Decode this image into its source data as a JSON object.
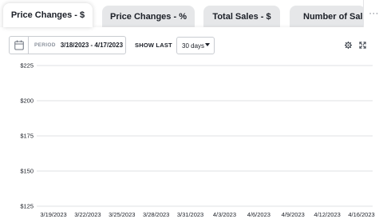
{
  "tabs": [
    {
      "label": "Price Changes - $",
      "active": true
    },
    {
      "label": "Price Changes - %",
      "active": false
    },
    {
      "label": "Total Sales - $",
      "active": false
    },
    {
      "label": "Number of Sales",
      "active": false
    }
  ],
  "more_label": "···",
  "toolbar": {
    "period_label": "PERIOD",
    "period_value": "3/18/2023 - 4/17/2023",
    "show_last_label": "SHOW LAST",
    "days_value": "30 days",
    "icons": [
      "calendar-icon",
      "gear-icon",
      "expand-icon"
    ]
  },
  "colors": {
    "active_tab_bg": "#ffffff",
    "inactive_tab_bg": "#e6e7e9",
    "grid": "#d4d6da",
    "text": "#1b1f27",
    "muted": "#8a919c"
  },
  "chart_data": {
    "type": "line",
    "title": "",
    "xlabel": "",
    "ylabel": "",
    "y_ticks": [
      "$225",
      "$200",
      "$175",
      "$150",
      "$125"
    ],
    "y_values": [
      225,
      200,
      175,
      150,
      125
    ],
    "ylim": [
      125,
      225
    ],
    "x_ticks": [
      "3/19/2023",
      "3/22/2023",
      "3/25/2023",
      "3/28/2023",
      "3/31/2023",
      "4/3/2023",
      "4/6/2023",
      "4/9/2023",
      "4/12/2023",
      "4/16/2023"
    ],
    "grid": true,
    "series": []
  }
}
